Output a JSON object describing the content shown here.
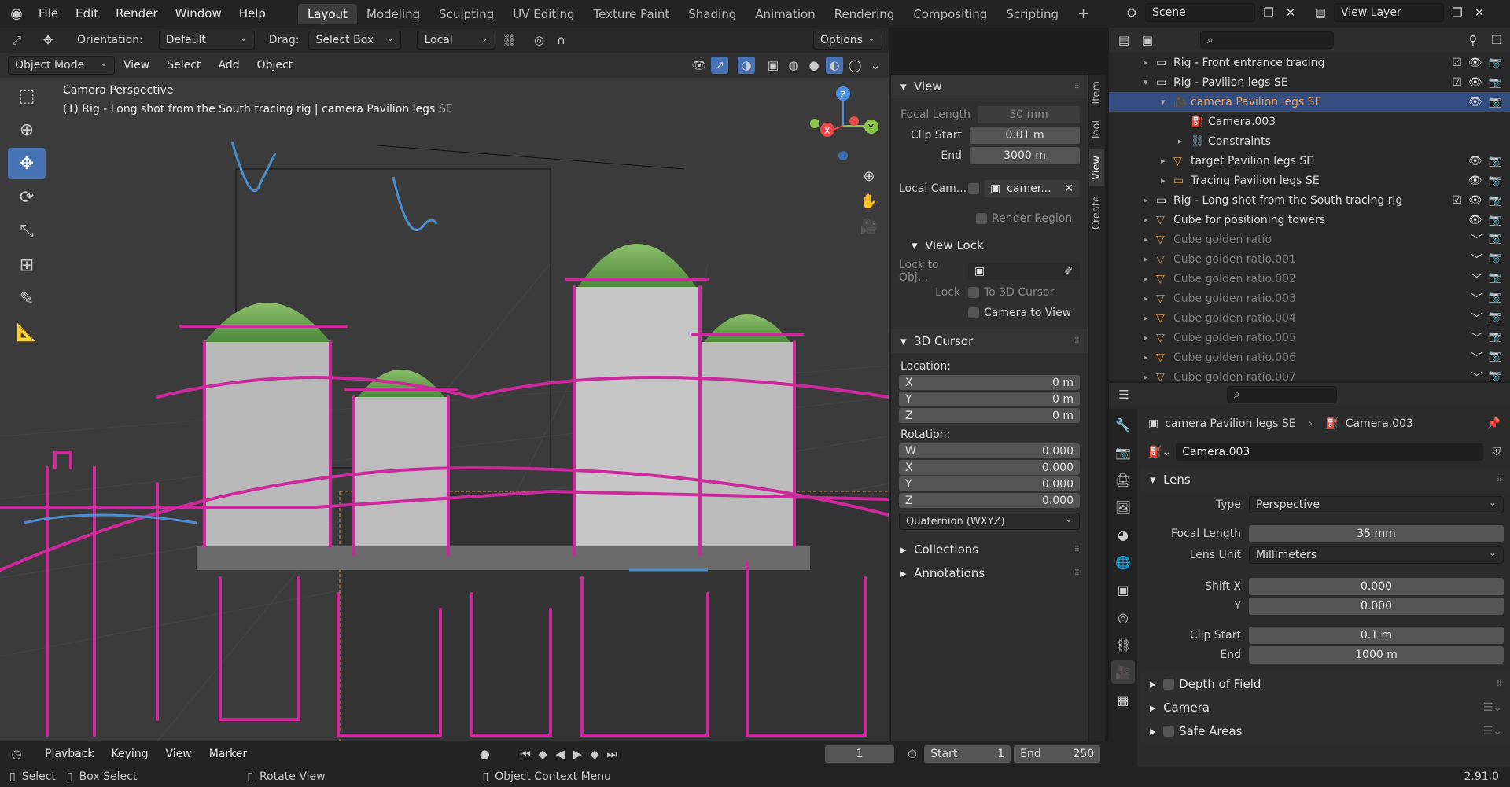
{
  "topbar": {
    "menus": [
      "File",
      "Edit",
      "Render",
      "Window",
      "Help"
    ],
    "workspaces": [
      "Layout",
      "Modeling",
      "Sculpting",
      "UV Editing",
      "Texture Paint",
      "Shading",
      "Animation",
      "Rendering",
      "Compositing",
      "Scripting"
    ],
    "active_workspace": "Layout",
    "scene": "Scene",
    "view_layer": "View Layer"
  },
  "header": {
    "orientation_label": "Orientation:",
    "orientation": "Default",
    "drag_label": "Drag:",
    "drag": "Select Box",
    "transform_space": "Local",
    "options": "Options",
    "mode": "Object Mode",
    "menus": [
      "View",
      "Select",
      "Add",
      "Object"
    ]
  },
  "viewport": {
    "title": "Camera Perspective",
    "subtitle": "(1) Rig - Long shot from the South tracing rig | camera Pavilion legs SE",
    "gizmo": {
      "x": "X",
      "y": "Y",
      "z": "Z"
    }
  },
  "npanel": {
    "tabs": [
      "Item",
      "Tool",
      "View",
      "Create"
    ],
    "active_tab": "View",
    "view": {
      "title": "View",
      "focal_length_label": "Focal Length",
      "focal_length": "50 mm",
      "clip_start_label": "Clip Start",
      "clip_start": "0.01 m",
      "end_label": "End",
      "end": "3000 m",
      "local_cam_label": "Local Cam...",
      "local_cam_value": "camer...",
      "render_region": "Render Region"
    },
    "view_lock": {
      "title": "View Lock",
      "lock_to_obj_label": "Lock to Obj...",
      "lock_label": "Lock",
      "to_3d_cursor": "To 3D Cursor",
      "camera_to_view": "Camera to View"
    },
    "cursor": {
      "title": "3D Cursor",
      "location_label": "Location:",
      "location": [
        {
          "axis": "X",
          "value": "0 m"
        },
        {
          "axis": "Y",
          "value": "0 m"
        },
        {
          "axis": "Z",
          "value": "0 m"
        }
      ],
      "rotation_label": "Rotation:",
      "rotation": [
        {
          "axis": "W",
          "value": "0.000"
        },
        {
          "axis": "X",
          "value": "0.000"
        },
        {
          "axis": "Y",
          "value": "0.000"
        },
        {
          "axis": "Z",
          "value": "0.000"
        }
      ],
      "rotation_mode": "Quaternion (WXYZ)"
    },
    "collections": "Collections",
    "annotations": "Annotations"
  },
  "outliner": {
    "rows": [
      {
        "label": "Rig - Front entrance tracing",
        "indent": 1,
        "type": "collection"
      },
      {
        "label": "Rig - Pavilion legs SE",
        "indent": 1,
        "type": "collection"
      },
      {
        "label": "camera Pavilion legs SE",
        "indent": 2,
        "type": "camera",
        "selected": true
      },
      {
        "label": "Camera.003",
        "indent": 3,
        "type": "camdata"
      },
      {
        "label": "Constraints",
        "indent": 3,
        "type": "constraint"
      },
      {
        "label": "target Pavilion legs SE",
        "indent": 2,
        "type": "mesh"
      },
      {
        "label": "Tracing Pavilion legs SE",
        "indent": 2,
        "type": "gpencil"
      },
      {
        "label": "Rig - Long shot from the South tracing rig",
        "indent": 1,
        "type": "collection"
      },
      {
        "label": "Cube for positioning towers",
        "indent": 1,
        "type": "mesh"
      },
      {
        "label": "Cube golden ratio",
        "indent": 1,
        "type": "mesh",
        "dim": true
      },
      {
        "label": "Cube golden ratio.001",
        "indent": 1,
        "type": "mesh",
        "dim": true
      },
      {
        "label": "Cube golden ratio.002",
        "indent": 1,
        "type": "mesh",
        "dim": true
      },
      {
        "label": "Cube golden ratio.003",
        "indent": 1,
        "type": "mesh",
        "dim": true
      },
      {
        "label": "Cube golden ratio.004",
        "indent": 1,
        "type": "mesh",
        "dim": true
      },
      {
        "label": "Cube golden ratio.005",
        "indent": 1,
        "type": "mesh",
        "dim": true
      },
      {
        "label": "Cube golden ratio.006",
        "indent": 1,
        "type": "mesh",
        "dim": true
      },
      {
        "label": "Cube golden ratio.007",
        "indent": 1,
        "type": "mesh",
        "dim": true
      }
    ]
  },
  "properties": {
    "breadcrumb_object": "camera Pavilion legs SE",
    "breadcrumb_data": "Camera.003",
    "datablock": "Camera.003",
    "lens": {
      "title": "Lens",
      "type_label": "Type",
      "type": "Perspective",
      "focal_length_label": "Focal Length",
      "focal_length": "35 mm",
      "lens_unit_label": "Lens Unit",
      "lens_unit": "Millimeters",
      "shift_x_label": "Shift X",
      "shift_x": "0.000",
      "y_label": "Y",
      "shift_y": "0.000",
      "clip_start_label": "Clip Start",
      "clip_start": "0.1 m",
      "end_label": "End",
      "clip_end": "1000 m"
    },
    "panels": [
      "Depth of Field",
      "Camera",
      "Safe Areas"
    ]
  },
  "timeline": {
    "menus": [
      "Playback",
      "Keying",
      "View",
      "Marker"
    ],
    "current_frame": "1",
    "start_label": "Start",
    "start": "1",
    "end_label": "End",
    "end": "250"
  },
  "status": {
    "select": "Select",
    "box_select": "Box Select",
    "rotate_view": "Rotate View",
    "context_menu": "Object Context Menu",
    "version": "2.91.0"
  },
  "colors": {
    "accent": "#4772b3",
    "trace": "#cc2a9c",
    "selection": "#334d80"
  }
}
